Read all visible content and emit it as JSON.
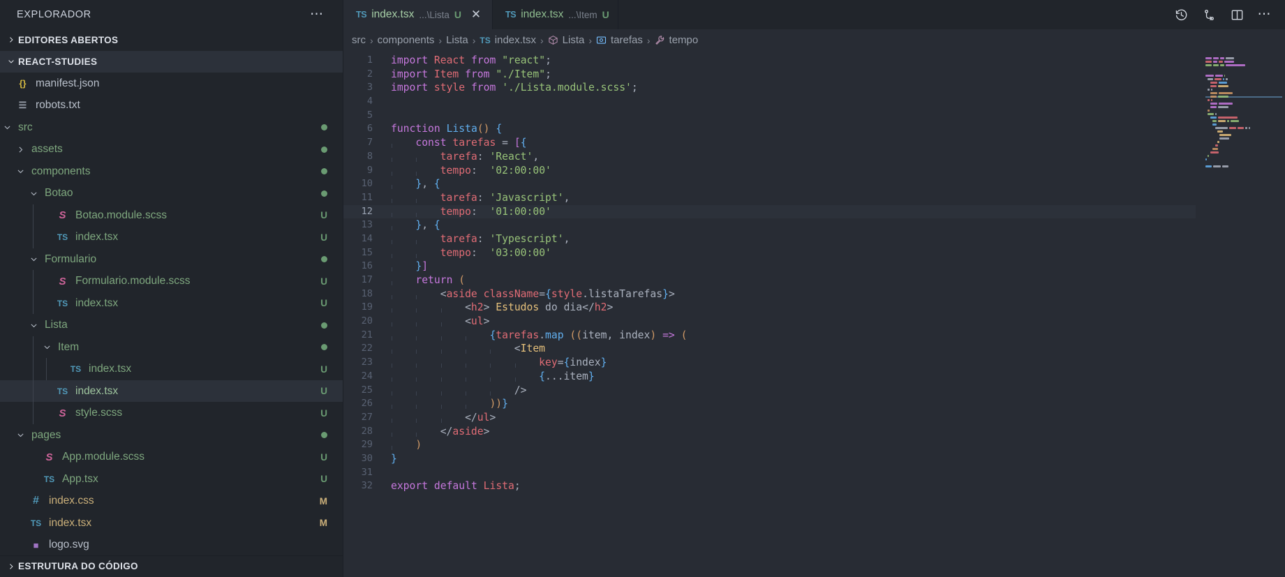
{
  "sidebar": {
    "title": "EXPLORADOR",
    "more_label": "⋯",
    "sections": [
      {
        "label": "EDITORES ABERTOS",
        "expanded": false
      },
      {
        "label": "REACT-STUDIES",
        "expanded": true
      }
    ],
    "bottom_section": {
      "label": "ESTRUTURA DO CÓDIGO",
      "expanded": false
    },
    "tree": [
      {
        "name": "manifest.json",
        "icon": "json-icon",
        "depth": 1,
        "type": "file",
        "badge": "",
        "color": "#b9c0cb",
        "icon_color": "#d4b942",
        "icon_text": "{}"
      },
      {
        "name": "robots.txt",
        "icon": "text-icon",
        "depth": 1,
        "type": "file",
        "badge": "",
        "color": "#b9c0cb",
        "icon_color": "#9aa1ac",
        "icon_text": "☰"
      },
      {
        "name": "src",
        "icon": "folder-icon",
        "depth": 1,
        "type": "folder",
        "badge": "dot",
        "color": "#7ea77e",
        "expanded": true,
        "icon_color": "",
        "icon_text": ""
      },
      {
        "name": "assets",
        "icon": "folder-icon",
        "depth": 2,
        "type": "folder",
        "badge": "dot",
        "color": "#7ea77e",
        "expanded": false,
        "icon_color": "",
        "icon_text": ""
      },
      {
        "name": "components",
        "icon": "folder-icon",
        "depth": 2,
        "type": "folder",
        "badge": "dot",
        "color": "#7ea77e",
        "expanded": true,
        "icon_color": "",
        "icon_text": ""
      },
      {
        "name": "Botao",
        "icon": "folder-icon",
        "depth": 3,
        "type": "folder",
        "badge": "dot",
        "color": "#7ea77e",
        "expanded": true,
        "icon_color": "",
        "icon_text": ""
      },
      {
        "name": "Botao.module.scss",
        "icon": "sass-icon",
        "depth": 4,
        "type": "file",
        "badge": "U",
        "color": "#7ea77e",
        "icon_color": "#cf649a",
        "icon_text": "S"
      },
      {
        "name": "index.tsx",
        "icon": "ts-icon",
        "depth": 4,
        "type": "file",
        "badge": "U",
        "color": "#7ea77e",
        "icon_color": "#519aba",
        "icon_text": "TS"
      },
      {
        "name": "Formulario",
        "icon": "folder-icon",
        "depth": 3,
        "type": "folder",
        "badge": "dot",
        "color": "#7ea77e",
        "expanded": true,
        "icon_color": "",
        "icon_text": ""
      },
      {
        "name": "Formulario.module.scss",
        "icon": "sass-icon",
        "depth": 4,
        "type": "file",
        "badge": "U",
        "color": "#7ea77e",
        "icon_color": "#cf649a",
        "icon_text": "S"
      },
      {
        "name": "index.tsx",
        "icon": "ts-icon",
        "depth": 4,
        "type": "file",
        "badge": "U",
        "color": "#7ea77e",
        "icon_color": "#519aba",
        "icon_text": "TS"
      },
      {
        "name": "Lista",
        "icon": "folder-icon",
        "depth": 3,
        "type": "folder",
        "badge": "dot",
        "color": "#7ea77e",
        "expanded": true,
        "icon_color": "",
        "icon_text": ""
      },
      {
        "name": "Item",
        "icon": "folder-icon",
        "depth": 4,
        "type": "folder",
        "badge": "dot",
        "color": "#7ea77e",
        "expanded": true,
        "icon_color": "",
        "icon_text": ""
      },
      {
        "name": "index.tsx",
        "icon": "ts-icon",
        "depth": 5,
        "type": "file",
        "badge": "U",
        "color": "#7ea77e",
        "icon_color": "#519aba",
        "icon_text": "TS"
      },
      {
        "name": "index.tsx",
        "icon": "ts-icon",
        "depth": 4,
        "type": "file",
        "badge": "U",
        "color": "#9ec49e",
        "icon_color": "#519aba",
        "icon_text": "TS",
        "selected": true
      },
      {
        "name": "style.scss",
        "icon": "sass-icon",
        "depth": 4,
        "type": "file",
        "badge": "U",
        "color": "#7ea77e",
        "icon_color": "#cf649a",
        "icon_text": "S"
      },
      {
        "name": "pages",
        "icon": "folder-icon",
        "depth": 2,
        "type": "folder",
        "badge": "dot",
        "color": "#7ea77e",
        "expanded": true,
        "icon_color": "",
        "icon_text": ""
      },
      {
        "name": "App.module.scss",
        "icon": "sass-icon",
        "depth": 3,
        "type": "file",
        "badge": "U",
        "color": "#7ea77e",
        "icon_color": "#cf649a",
        "icon_text": "S"
      },
      {
        "name": "App.tsx",
        "icon": "ts-icon",
        "depth": 3,
        "type": "file",
        "badge": "U",
        "color": "#7ea77e",
        "icon_color": "#519aba",
        "icon_text": "TS"
      },
      {
        "name": "index.css",
        "icon": "css-icon",
        "depth": 2,
        "type": "file",
        "badge": "M",
        "color": "#cbb07a",
        "icon_color": "#519aba",
        "icon_text": "#"
      },
      {
        "name": "index.tsx",
        "icon": "ts-icon",
        "depth": 2,
        "type": "file",
        "badge": "M",
        "color": "#cbb07a",
        "icon_color": "#519aba",
        "icon_text": "TS"
      },
      {
        "name": "logo.svg",
        "icon": "svg-icon",
        "depth": 2,
        "type": "file",
        "badge": "",
        "color": "#b9c0cb",
        "icon_color": "#a074c4",
        "icon_text": "■"
      }
    ],
    "badge_colors": {
      "U": "#6a9b72",
      "M": "#cbb07a",
      "dot": "#6a9b72"
    }
  },
  "tabs": [
    {
      "icon": "ts-icon",
      "icon_text": "TS",
      "name": "index.tsx",
      "path": "...\\Lista",
      "status": "U",
      "active": true,
      "closable": true,
      "close_label": "✕"
    },
    {
      "icon": "ts-icon",
      "icon_text": "TS",
      "name": "index.tsx",
      "path": "...\\Item",
      "status": "U",
      "active": false,
      "closable": false,
      "close_label": ""
    }
  ],
  "tab_actions": [
    {
      "name": "history-icon",
      "label": "history"
    },
    {
      "name": "source-control-icon",
      "label": "source control"
    },
    {
      "name": "split-editor-icon",
      "label": "split editor"
    },
    {
      "name": "more-actions-icon",
      "label": "⋯"
    }
  ],
  "breadcrumb": [
    {
      "label": "src",
      "icon": ""
    },
    {
      "label": "components",
      "icon": ""
    },
    {
      "label": "Lista",
      "icon": ""
    },
    {
      "label": "index.tsx",
      "icon": "ts-icon"
    },
    {
      "label": "Lista",
      "icon": "class-icon"
    },
    {
      "label": "tarefas",
      "icon": "variable-icon"
    },
    {
      "label": "tempo",
      "icon": "property-icon"
    }
  ],
  "breadcrumb_separator": "›",
  "editor": {
    "language": "typescriptreact",
    "highlighted_line": 12,
    "total_lines": 32,
    "lines": [
      {
        "n": 1,
        "text": "import React from \"react\";"
      },
      {
        "n": 2,
        "text": "import Item from \"./Item\";"
      },
      {
        "n": 3,
        "text": "import style from './Lista.module.scss';"
      },
      {
        "n": 4,
        "text": ""
      },
      {
        "n": 5,
        "text": ""
      },
      {
        "n": 6,
        "text": "function Lista() {"
      },
      {
        "n": 7,
        "text": "    const tarefas = [{"
      },
      {
        "n": 8,
        "text": "        tarefa: 'React',"
      },
      {
        "n": 9,
        "text": "        tempo:  '02:00:00'"
      },
      {
        "n": 10,
        "text": "    }, {"
      },
      {
        "n": 11,
        "text": "        tarefa: 'Javascript',"
      },
      {
        "n": 12,
        "text": "        tempo:  '01:00:00'"
      },
      {
        "n": 13,
        "text": "    }, {"
      },
      {
        "n": 14,
        "text": "        tarefa: 'Typescript',"
      },
      {
        "n": 15,
        "text": "        tempo:  '03:00:00'"
      },
      {
        "n": 16,
        "text": "    }]"
      },
      {
        "n": 17,
        "text": "    return ("
      },
      {
        "n": 18,
        "text": "        <aside className={style.listaTarefas}>"
      },
      {
        "n": 19,
        "text": "            <h2> Estudos do dia</h2>"
      },
      {
        "n": 20,
        "text": "            <ul>"
      },
      {
        "n": 21,
        "text": "                {tarefas.map ((item, index) => ("
      },
      {
        "n": 22,
        "text": "                    <Item"
      },
      {
        "n": 23,
        "text": "                        key={index}"
      },
      {
        "n": 24,
        "text": "                        {...item}"
      },
      {
        "n": 25,
        "text": "                    />"
      },
      {
        "n": 26,
        "text": "                ))}"
      },
      {
        "n": 27,
        "text": "            </ul>"
      },
      {
        "n": 28,
        "text": "        </aside>"
      },
      {
        "n": 29,
        "text": "    )"
      },
      {
        "n": 30,
        "text": "}"
      },
      {
        "n": 31,
        "text": ""
      },
      {
        "n": 32,
        "text": "export default Lista;"
      }
    ]
  },
  "theme": {
    "editor_bg": "#282c34",
    "sidebar_bg": "#21252b",
    "tabbar_bg": "#21252b",
    "active_tab_bg": "#282c34",
    "selection_bg": "#2c313a",
    "keyword": "#c678dd",
    "string": "#98c379",
    "variable": "#e06c75",
    "function": "#61afef",
    "number": "#d19a66",
    "component": "#e5c07b",
    "plain": "#abb2bf",
    "line_number": "#596273",
    "git_untracked": "#6a9b72",
    "git_modified": "#cbb07a"
  }
}
